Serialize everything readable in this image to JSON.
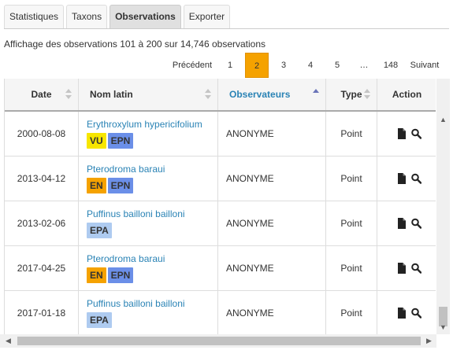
{
  "tabs": [
    {
      "label": "Statistiques",
      "active": false
    },
    {
      "label": "Taxons",
      "active": false
    },
    {
      "label": "Observations",
      "active": true
    },
    {
      "label": "Exporter",
      "active": false
    }
  ],
  "summary": "Affichage des observations 101 à 200 sur 14,746 observations",
  "pager": {
    "prev": "Précédent",
    "pages": [
      "1",
      "2",
      "3",
      "4",
      "5"
    ],
    "active": "2",
    "ellipsis": "…",
    "last": "148",
    "next": "Suivant"
  },
  "table": {
    "headers": [
      "Date",
      "Nom latin",
      "Observateurs",
      "Type",
      "Action"
    ],
    "sorted_column": "Observateurs",
    "rows": [
      {
        "date": "2000-08-08",
        "latin": "Erythroxylum hypericifolium",
        "badges": [
          {
            "text": "VU",
            "color": "#f7e600"
          },
          {
            "text": "EPN",
            "color": "#6b8fe8"
          }
        ],
        "observer": "ANONYME",
        "type": "Point"
      },
      {
        "date": "2013-04-12",
        "latin": "Pterodroma baraui",
        "badges": [
          {
            "text": "EN",
            "color": "#f5a200"
          },
          {
            "text": "EPN",
            "color": "#6b8fe8"
          }
        ],
        "observer": "ANONYME",
        "type": "Point"
      },
      {
        "date": "2013-02-06",
        "latin": "Puffinus bailloni bailloni",
        "badges": [
          {
            "text": "EPA",
            "color": "#aecbf0"
          }
        ],
        "observer": "ANONYME",
        "type": "Point"
      },
      {
        "date": "2017-04-25",
        "latin": "Pterodroma baraui",
        "badges": [
          {
            "text": "EN",
            "color": "#f5a200"
          },
          {
            "text": "EPN",
            "color": "#6b8fe8"
          }
        ],
        "observer": "ANONYME",
        "type": "Point"
      },
      {
        "date": "2017-01-18",
        "latin": "Puffinus bailloni bailloni",
        "badges": [
          {
            "text": "EPA",
            "color": "#aecbf0"
          }
        ],
        "observer": "ANONYME",
        "type": "Point"
      }
    ],
    "action_icons": [
      "document-icon",
      "magnifier-icon"
    ]
  },
  "colors": {
    "link": "#2a83b5",
    "pager_active": "#f5a200"
  }
}
